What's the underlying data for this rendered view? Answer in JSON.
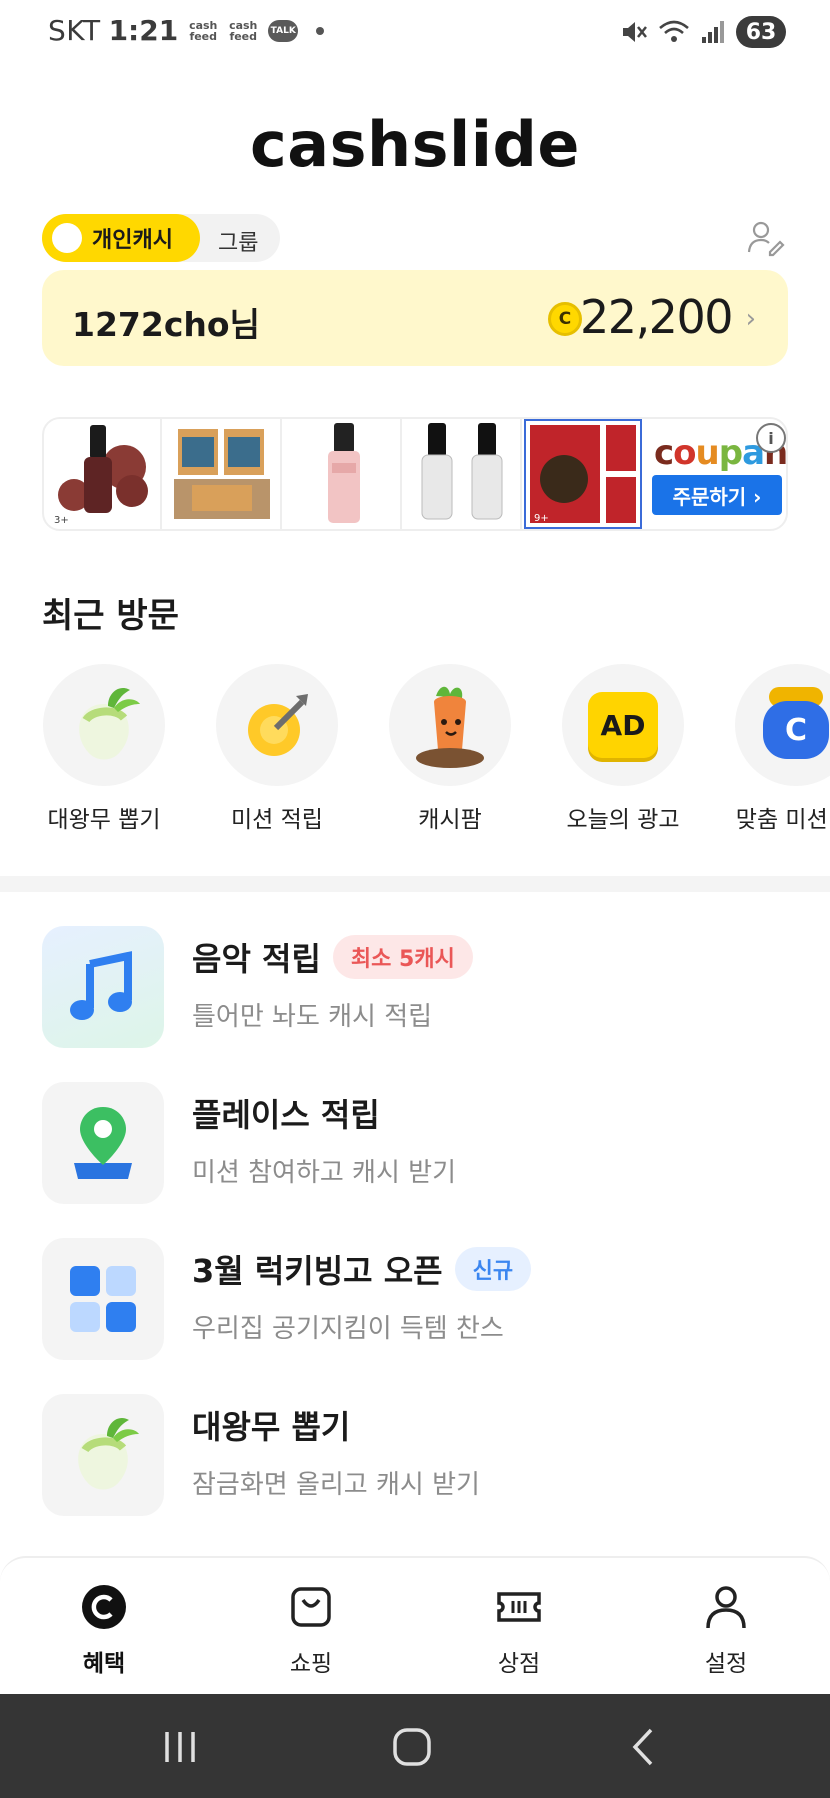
{
  "status_bar": {
    "carrier": "SKT",
    "time": "1:21",
    "notif_cash_feed_1": "cash feed",
    "notif_cash_feed_2": "cash feed",
    "notif_talk": "TALK",
    "battery": "63"
  },
  "header": {
    "logo": "cashslide"
  },
  "cash_toggle": {
    "personal_label": "개인캐시",
    "group_label": "그룹",
    "selected": "personal"
  },
  "balance": {
    "user": "1272cho님",
    "coin_symbol": "C",
    "amount": "22,200"
  },
  "ad_banner": {
    "brand": "coupang",
    "cta": "주문하기 ›",
    "info": "i",
    "thumb_badges": [
      "3+",
      "9+"
    ]
  },
  "recent_visits": {
    "title": "최근 방문",
    "items": [
      {
        "label": "대왕무 뽑기",
        "icon": "radish-icon"
      },
      {
        "label": "미션 적립",
        "icon": "target-icon"
      },
      {
        "label": "캐시팜",
        "icon": "carrot-icon"
      },
      {
        "label": "오늘의 광고",
        "icon": "ad-icon",
        "icon_text": "AD"
      },
      {
        "label": "맞춤 미션 적",
        "icon": "coin-bag-icon",
        "icon_text": "C"
      }
    ]
  },
  "features": [
    {
      "title": "음악 적립",
      "badge": "최소 5캐시",
      "badge_style": "red",
      "desc": "틀어만 놔도 캐시 적립",
      "icon": "music-note-icon"
    },
    {
      "title": "플레이스 적립",
      "badge": "",
      "desc": "미션 참여하고 캐시 받기",
      "icon": "map-pin-icon"
    },
    {
      "title": "3월 럭키빙고 오픈",
      "badge": "신규",
      "badge_style": "blue",
      "desc": "우리집 공기지킴이 득템 찬스",
      "icon": "bingo-grid-icon"
    },
    {
      "title": "대왕무 뽑기",
      "badge": "",
      "desc": "잠금화면 올리고 캐시 받기",
      "icon": "radish-icon"
    }
  ],
  "bottom_nav": {
    "items": [
      {
        "label": "혜택",
        "icon": "cash-c-icon",
        "active": true
      },
      {
        "label": "쇼핑",
        "icon": "shopping-bag-icon",
        "active": false
      },
      {
        "label": "상점",
        "icon": "ticket-icon",
        "active": false
      },
      {
        "label": "설정",
        "icon": "person-icon",
        "active": false
      }
    ]
  },
  "colors": {
    "brand_yellow": "#ffd800",
    "balance_bg": "#fff8cc",
    "badge_red": "#ea5757",
    "badge_blue": "#3b86f0",
    "coupang_blue": "#1a73e8"
  }
}
